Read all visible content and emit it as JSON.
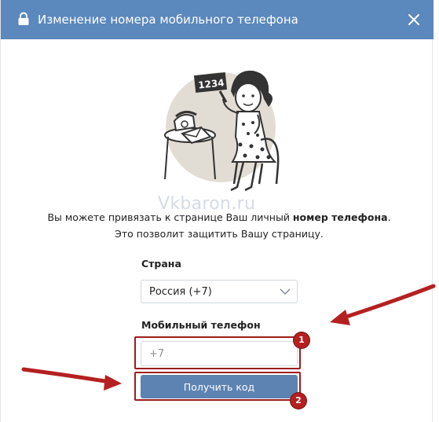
{
  "dialog": {
    "title": "Изменение номера мобильного телефона",
    "lock_icon": "lock-icon",
    "close_icon": "close-icon"
  },
  "illustration": {
    "sign_text": "1234"
  },
  "watermark": "Vkbaron.ru",
  "description": {
    "line1_start": "Вы можете привязать к странице Ваш личный ",
    "line1_bold": "номер телефона",
    "line1_end": ".",
    "line2": "Это позволит защитить Вашу страницу."
  },
  "country": {
    "label": "Страна",
    "selected": "Россия (+7)"
  },
  "phone": {
    "label": "Мобильный телефон",
    "placeholder": "+7",
    "value": ""
  },
  "submit": {
    "label": "Получить код"
  },
  "annotations": {
    "step1": "1",
    "step2": "2",
    "color": "#b52020"
  },
  "colors": {
    "header": "#5b88bd",
    "button": "#5d83b2"
  }
}
